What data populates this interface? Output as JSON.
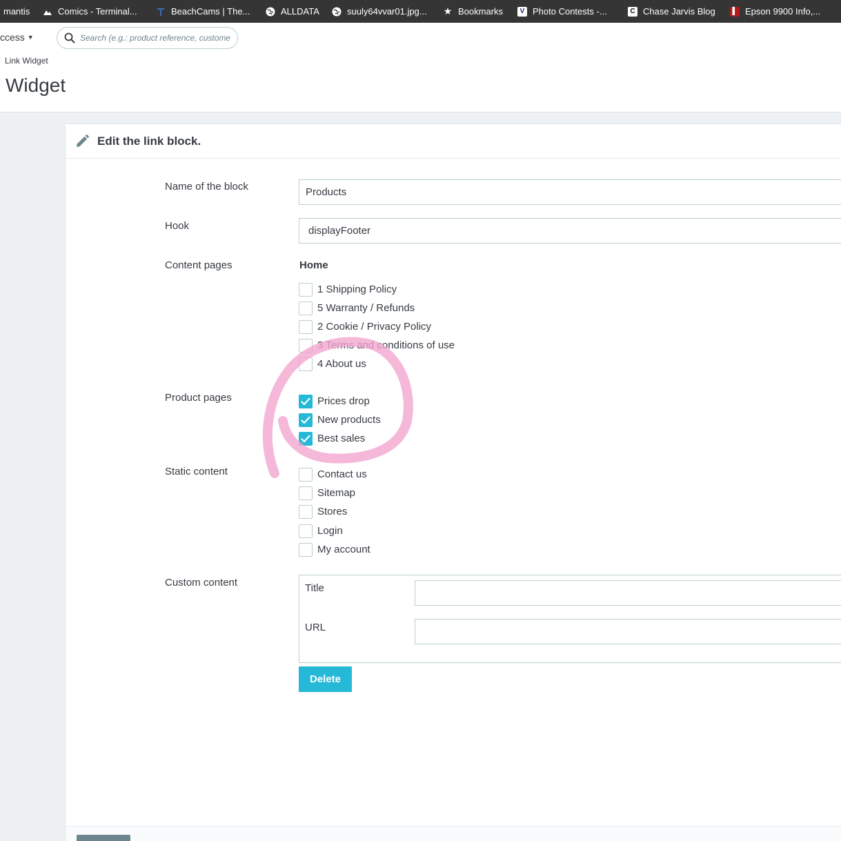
{
  "bookmarks": [
    {
      "label": "mantis",
      "icon": "none"
    },
    {
      "label": "Comics - Terminal...",
      "icon": "mountain-icon"
    },
    {
      "label": "BeachCams | The...",
      "icon": "beachcams-icon"
    },
    {
      "label": "ALLDATA",
      "icon": "globe-icon"
    },
    {
      "label": "suuly64vvar01.jpg...",
      "icon": "globe-icon"
    },
    {
      "label": "Bookmarks",
      "icon": "star-icon"
    },
    {
      "label": "Photo Contests -...",
      "icon": "v-logo-icon"
    },
    {
      "label": "Chase Jarvis Blog",
      "icon": "cj-logo-icon"
    },
    {
      "label": "Epson 9900 Info,...",
      "icon": "epson-icon"
    }
  ],
  "header": {
    "quick_access": "ccess",
    "search_placeholder": "Search (e.g.: product reference, custome",
    "breadcrumb": "Link Widget",
    "page_title": "Widget"
  },
  "form": {
    "heading": "Edit the link block.",
    "name_label": "Name of the block",
    "name_value": "Products",
    "hook_label": "Hook",
    "hook_value": "displayFooter",
    "content_pages_label": "Content pages",
    "content_pages_group": "Home",
    "content_pages": [
      {
        "label": "1 Shipping Policy",
        "checked": false
      },
      {
        "label": "5 Warranty / Refunds",
        "checked": false
      },
      {
        "label": "2 Cookie / Privacy Policy",
        "checked": false
      },
      {
        "label": "3 Terms and conditions of use",
        "checked": false
      },
      {
        "label": "4 About us",
        "checked": false
      }
    ],
    "product_pages_label": "Product pages",
    "product_pages": [
      {
        "label": "Prices drop",
        "checked": true
      },
      {
        "label": "New products",
        "checked": true
      },
      {
        "label": "Best sales",
        "checked": true
      }
    ],
    "static_content_label": "Static content",
    "static_content": [
      {
        "label": "Contact us",
        "checked": false
      },
      {
        "label": "Sitemap",
        "checked": false
      },
      {
        "label": "Stores",
        "checked": false
      },
      {
        "label": "Login",
        "checked": false
      },
      {
        "label": "My account",
        "checked": false
      }
    ],
    "custom_content_label": "Custom content",
    "custom_title_label": "Title",
    "custom_url_label": "URL",
    "delete_label": "Delete"
  },
  "colors": {
    "accent": "#25b9d7",
    "annotation": "#f2a6cf",
    "bookmarks_bar": "#353535"
  }
}
